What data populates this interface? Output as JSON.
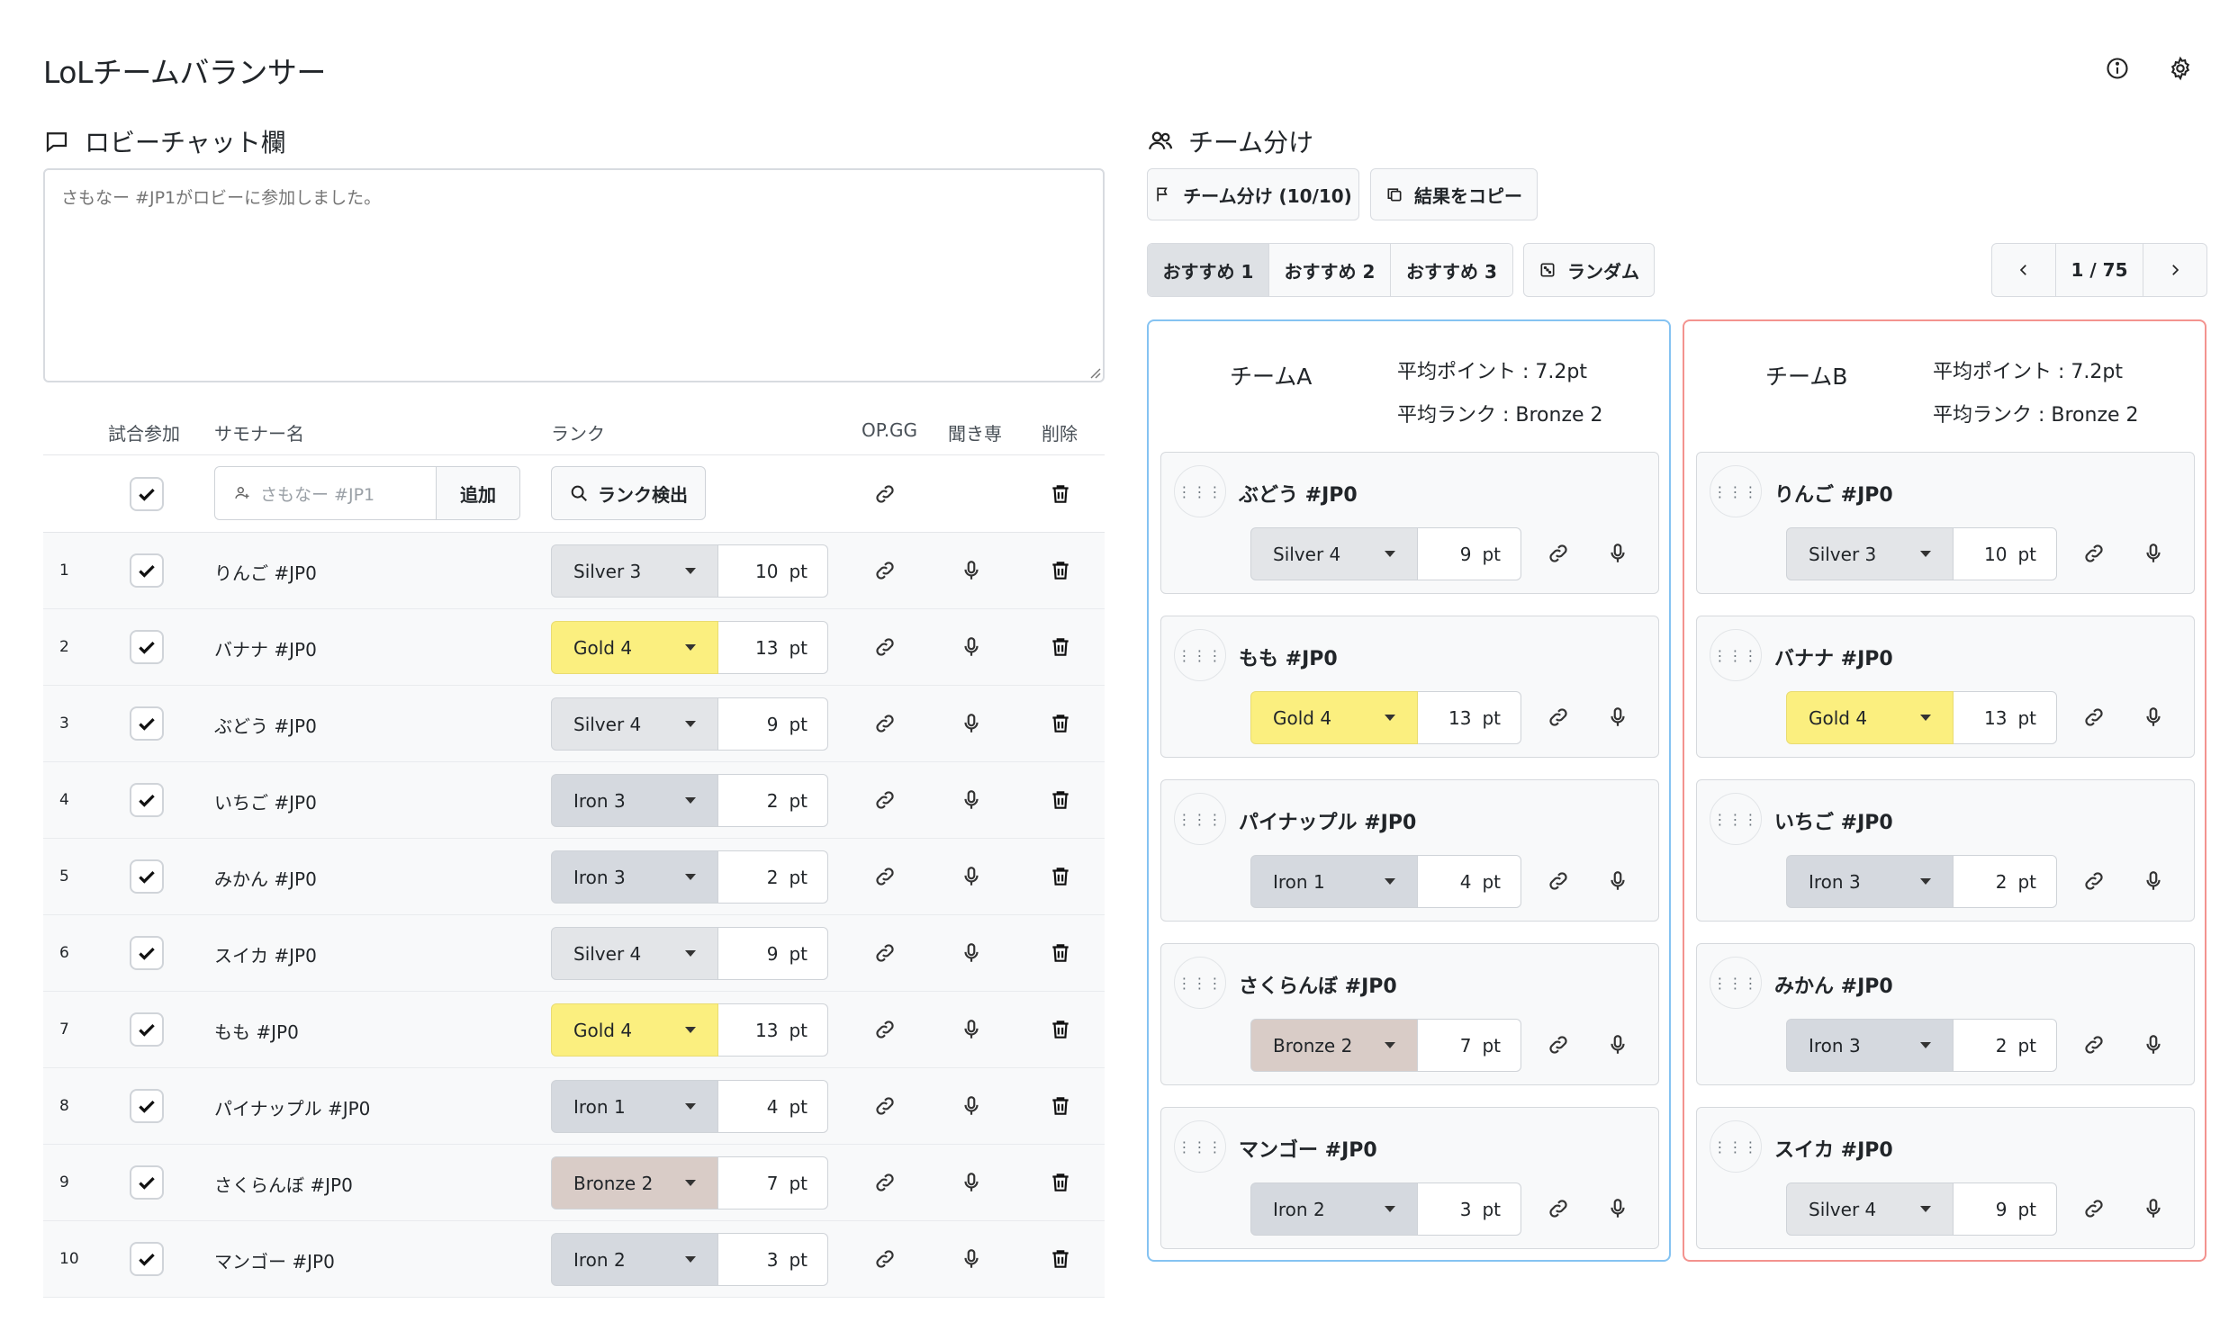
{
  "app": {
    "title": "LoLチームバランサー"
  },
  "header_icons": [
    "info-icon",
    "gear-icon"
  ],
  "chat": {
    "title": "ロビーチャット欄",
    "placeholder": "さもなー #JP1がロビーに参加しました。"
  },
  "table": {
    "headers": {
      "join": "試合参加",
      "summoner": "サモナー名",
      "rank": "ランク",
      "opgg": "OP.GG",
      "listen": "聞き専",
      "delete": "削除"
    },
    "add_row": {
      "placeholder": "さもなー #JP1",
      "add_button": "追加",
      "rank_detect": "ランク検出"
    },
    "pt_unit": "pt",
    "players": [
      {
        "no": "1",
        "name": "りんご #JP0",
        "rank": "Silver 3",
        "pt": "10",
        "tier": "silver"
      },
      {
        "no": "2",
        "name": "バナナ #JP0",
        "rank": "Gold 4",
        "pt": "13",
        "tier": "gold"
      },
      {
        "no": "3",
        "name": "ぶどう #JP0",
        "rank": "Silver 4",
        "pt": "9",
        "tier": "silver"
      },
      {
        "no": "4",
        "name": "いちご #JP0",
        "rank": "Iron 3",
        "pt": "2",
        "tier": "iron"
      },
      {
        "no": "5",
        "name": "みかん #JP0",
        "rank": "Iron 3",
        "pt": "2",
        "tier": "iron"
      },
      {
        "no": "6",
        "name": "スイカ #JP0",
        "rank": "Silver 4",
        "pt": "9",
        "tier": "silver"
      },
      {
        "no": "7",
        "name": "もも #JP0",
        "rank": "Gold 4",
        "pt": "13",
        "tier": "gold"
      },
      {
        "no": "8",
        "name": "パイナップル #JP0",
        "rank": "Iron 1",
        "pt": "4",
        "tier": "iron"
      },
      {
        "no": "9",
        "name": "さくらんぼ #JP0",
        "rank": "Bronze 2",
        "pt": "7",
        "tier": "bronze"
      },
      {
        "no": "10",
        "name": "マンゴー #JP0",
        "rank": "Iron 2",
        "pt": "3",
        "tier": "iron"
      }
    ]
  },
  "teams_section": {
    "title": "チーム分け",
    "split_button": "チーム分け (10/10)",
    "copy_button": "結果をコピー",
    "tabs": [
      "おすすめ 1",
      "おすすめ 2",
      "おすすめ 3"
    ],
    "active_tab": 0,
    "random_button": "ランダム",
    "pager": {
      "current": "1 / 75"
    },
    "teams": [
      {
        "name": "チームA",
        "avg_point": "平均ポイント : 7.2pt",
        "avg_rank": "平均ランク : Bronze 2",
        "border_color": "#85c3f2",
        "members": [
          {
            "name": "ぶどう #JP0",
            "rank": "Silver 4",
            "pt": "9",
            "tier": "silver"
          },
          {
            "name": "もも #JP0",
            "rank": "Gold 4",
            "pt": "13",
            "tier": "gold"
          },
          {
            "name": "パイナップル #JP0",
            "rank": "Iron 1",
            "pt": "4",
            "tier": "iron"
          },
          {
            "name": "さくらんぼ #JP0",
            "rank": "Bronze 2",
            "pt": "7",
            "tier": "bronze"
          },
          {
            "name": "マンゴー #JP0",
            "rank": "Iron 2",
            "pt": "3",
            "tier": "iron"
          }
        ]
      },
      {
        "name": "チームB",
        "avg_point": "平均ポイント : 7.2pt",
        "avg_rank": "平均ランク : Bronze 2",
        "border_color": "#f3938f",
        "members": [
          {
            "name": "りんご #JP0",
            "rank": "Silver 3",
            "pt": "10",
            "tier": "silver"
          },
          {
            "name": "バナナ #JP0",
            "rank": "Gold 4",
            "pt": "13",
            "tier": "gold"
          },
          {
            "name": "いちご #JP0",
            "rank": "Iron 3",
            "pt": "2",
            "tier": "iron"
          },
          {
            "name": "みかん #JP0",
            "rank": "Iron 3",
            "pt": "2",
            "tier": "iron"
          },
          {
            "name": "スイカ #JP0",
            "rank": "Silver 4",
            "pt": "9",
            "tier": "silver"
          }
        ]
      }
    ]
  },
  "colors": {
    "tier_silver": "#e3e5e8",
    "tier_gold": "#fbef7f",
    "tier_iron": "#d5d9df",
    "tier_bronze": "#d9ccc7"
  }
}
